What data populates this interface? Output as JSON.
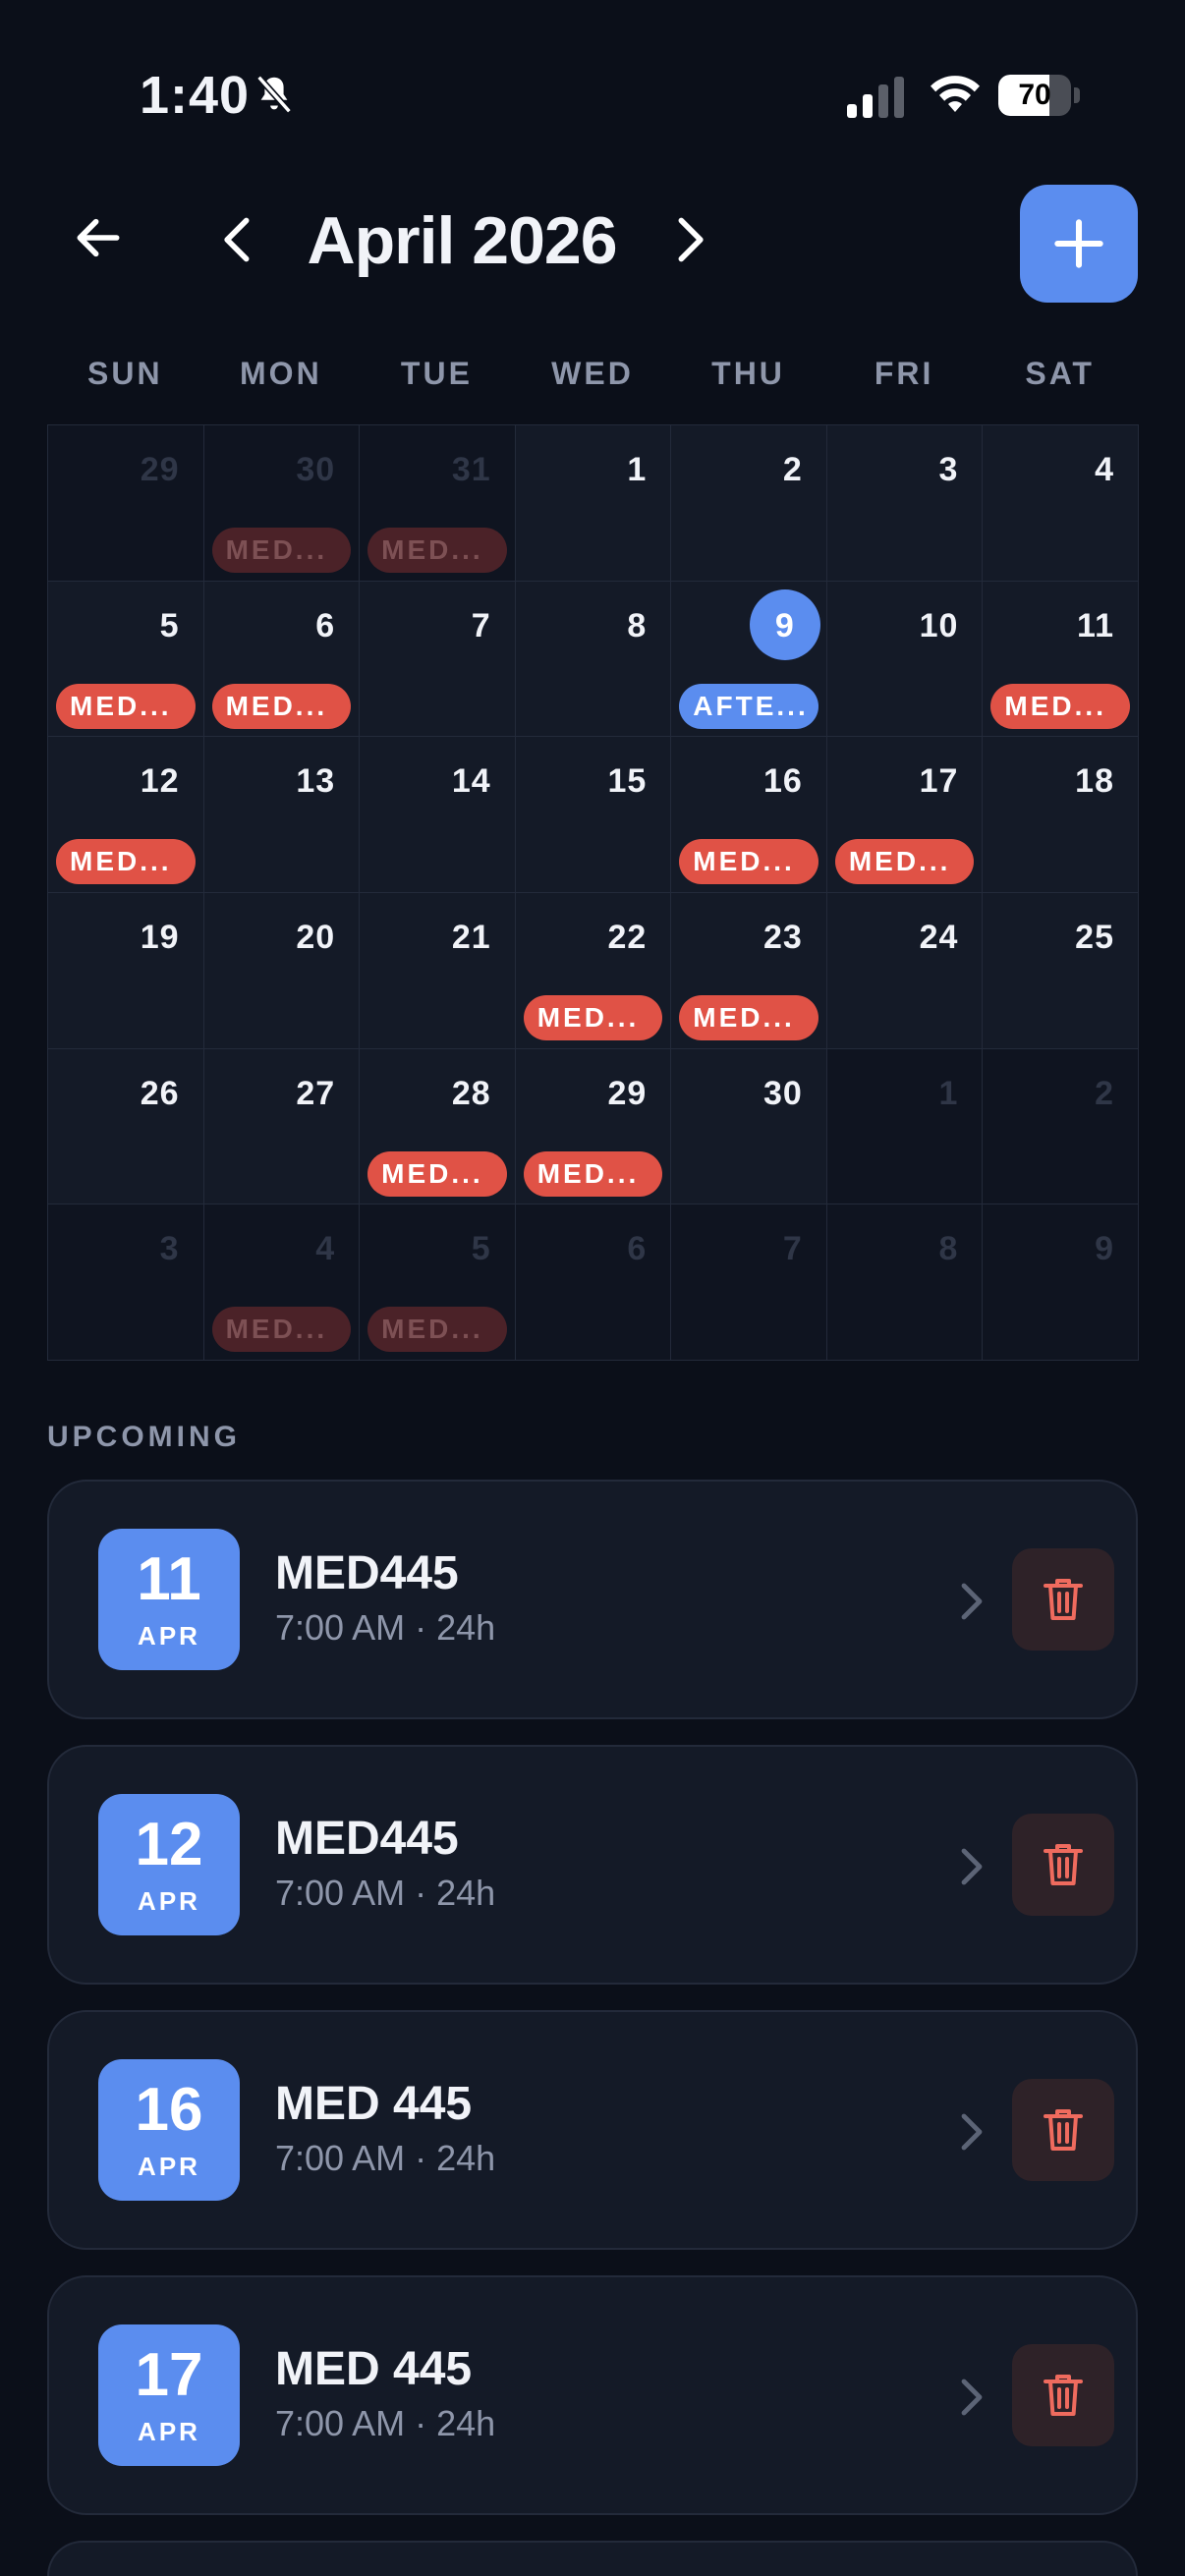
{
  "status_bar": {
    "time": "1:40",
    "battery": "70",
    "battery_level": 0.7
  },
  "header": {
    "month_title": "April 2026"
  },
  "weekdays": [
    "SUN",
    "MON",
    "TUE",
    "WED",
    "THU",
    "FRI",
    "SAT"
  ],
  "calendar": {
    "cells": [
      {
        "day": "29",
        "out": true
      },
      {
        "day": "30",
        "out": true,
        "event": "MED..."
      },
      {
        "day": "31",
        "out": true,
        "event": "MED..."
      },
      {
        "day": "1"
      },
      {
        "day": "2"
      },
      {
        "day": "3"
      },
      {
        "day": "4"
      },
      {
        "day": "5",
        "event": "MED..."
      },
      {
        "day": "6",
        "event": "MED..."
      },
      {
        "day": "7"
      },
      {
        "day": "8"
      },
      {
        "day": "9",
        "today": true,
        "event": "AFTE...",
        "event_color": "blue"
      },
      {
        "day": "10"
      },
      {
        "day": "11",
        "event": "MED..."
      },
      {
        "day": "12",
        "event": "MED..."
      },
      {
        "day": "13"
      },
      {
        "day": "14"
      },
      {
        "day": "15"
      },
      {
        "day": "16",
        "event": "MED..."
      },
      {
        "day": "17",
        "event": "MED..."
      },
      {
        "day": "18"
      },
      {
        "day": "19"
      },
      {
        "day": "20"
      },
      {
        "day": "21"
      },
      {
        "day": "22",
        "event": "MED..."
      },
      {
        "day": "23",
        "event": "MED..."
      },
      {
        "day": "24"
      },
      {
        "day": "25"
      },
      {
        "day": "26"
      },
      {
        "day": "27"
      },
      {
        "day": "28",
        "event": "MED..."
      },
      {
        "day": "29",
        "event": "MED..."
      },
      {
        "day": "30"
      },
      {
        "day": "1",
        "out": true
      },
      {
        "day": "2",
        "out": true
      },
      {
        "day": "3",
        "out": true
      },
      {
        "day": "4",
        "out": true,
        "event": "MED..."
      },
      {
        "day": "5",
        "out": true,
        "event": "MED..."
      },
      {
        "day": "6",
        "out": true
      },
      {
        "day": "7",
        "out": true
      },
      {
        "day": "8",
        "out": true
      },
      {
        "day": "9",
        "out": true
      }
    ]
  },
  "upcoming": {
    "label": "UPCOMING",
    "items": [
      {
        "day": "11",
        "month": "APR",
        "title": "MED445",
        "subtitle": "7:00 AM · 24h"
      },
      {
        "day": "12",
        "month": "APR",
        "title": "MED445",
        "subtitle": "7:00 AM · 24h"
      },
      {
        "day": "16",
        "month": "APR",
        "title": "MED 445",
        "subtitle": "7:00 AM · 24h"
      },
      {
        "day": "17",
        "month": "APR",
        "title": "MED 445",
        "subtitle": "7:00 AM · 24h"
      }
    ]
  },
  "colors": {
    "accent": "#5b8def",
    "event_red": "#e05246",
    "background": "#0b0f19",
    "card": "#141a27"
  },
  "icons": [
    "bell-slash-icon",
    "signal-icon",
    "wifi-icon",
    "battery-icon",
    "back-arrow-icon",
    "chevron-left-icon",
    "chevron-right-icon",
    "plus-icon",
    "trash-icon"
  ]
}
